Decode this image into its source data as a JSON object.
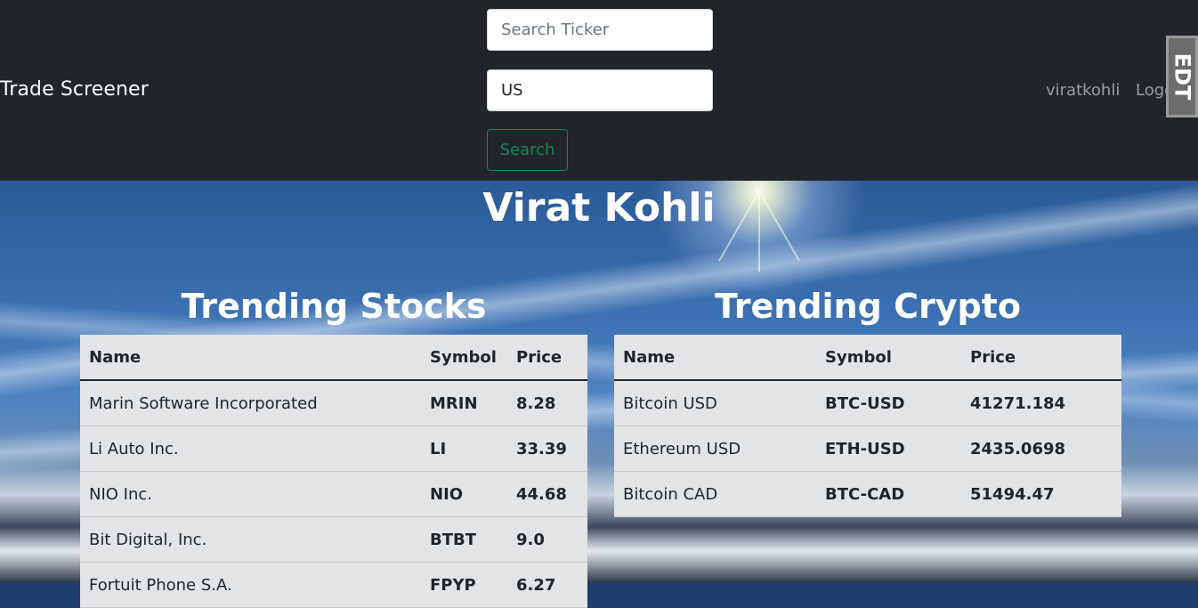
{
  "navbar": {
    "brand": "Trade Screener",
    "search_placeholder": "Search Ticker",
    "country_value": "US",
    "search_button": "Search",
    "user_link": "viratkohli",
    "logout_link": "Logout",
    "extension_badge": "EDT"
  },
  "main": {
    "title": "Virat Kohli"
  },
  "stocks": {
    "title": "Trending Stocks",
    "headers": [
      "Name",
      "Symbol",
      "Price"
    ],
    "rows": [
      {
        "name": "Marin Software Incorporated",
        "symbol": "MRIN",
        "price": "8.28"
      },
      {
        "name": "Li Auto Inc.",
        "symbol": "LI",
        "price": "33.39"
      },
      {
        "name": "NIO Inc.",
        "symbol": "NIO",
        "price": "44.68"
      },
      {
        "name": "Bit Digital, Inc.",
        "symbol": "BTBT",
        "price": "9.0"
      },
      {
        "name": "Fortuit Phone S.A.",
        "symbol": "FPYP",
        "price": "6.27"
      }
    ]
  },
  "crypto": {
    "title": "Trending Crypto",
    "headers": [
      "Name",
      "Symbol",
      "Price"
    ],
    "rows": [
      {
        "name": "Bitcoin USD",
        "symbol": "BTC-USD",
        "price": "41271.184"
      },
      {
        "name": "Ethereum USD",
        "symbol": "ETH-USD",
        "price": "2435.0698"
      },
      {
        "name": "Bitcoin CAD",
        "symbol": "BTC-CAD",
        "price": "51494.47"
      }
    ]
  },
  "colors": {
    "navbar_bg": "#212529",
    "success": "#198754",
    "table_bg": "#e3e4e6"
  }
}
